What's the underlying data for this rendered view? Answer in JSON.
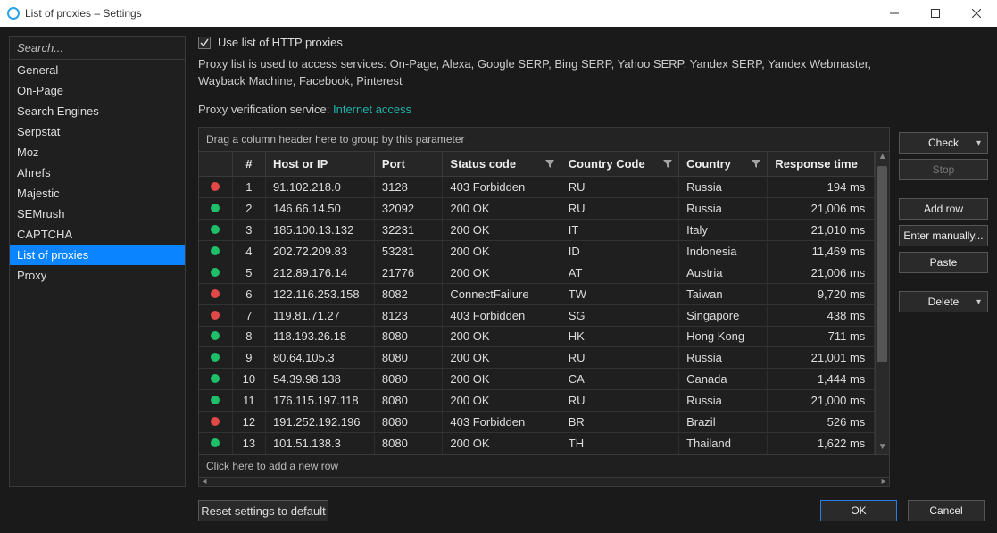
{
  "window": {
    "title": "List of proxies – Settings"
  },
  "sidebar": {
    "search_placeholder": "Search...",
    "items": [
      {
        "label": "General"
      },
      {
        "label": "On-Page"
      },
      {
        "label": "Search Engines"
      },
      {
        "label": "Serpstat"
      },
      {
        "label": "Moz"
      },
      {
        "label": "Ahrefs"
      },
      {
        "label": "Majestic"
      },
      {
        "label": "SEMrush"
      },
      {
        "label": "CAPTCHA"
      },
      {
        "label": "List of proxies"
      },
      {
        "label": "Proxy"
      }
    ],
    "selected_index": 9
  },
  "main": {
    "checkbox_label": "Use list of HTTP proxies",
    "checkbox_checked": true,
    "description": "Proxy list is used to access services: On-Page, Alexa, Google SERP, Bing SERP, Yahoo SERP, Yandex SERP, Yandex Webmaster, Wayback Machine, Facebook, Pinterest",
    "verification_label": "Proxy verification service: ",
    "verification_link": "Internet access",
    "group_hint": "Drag a column header here to group by this parameter",
    "columns": {
      "num": "#",
      "host": "Host or IP",
      "port": "Port",
      "status": "Status code",
      "cc": "Country Code",
      "country": "Country",
      "rt": "Response time"
    },
    "rows": [
      {
        "ok": false,
        "n": "1",
        "ip": "91.102.218.0",
        "port": "3128",
        "status": "403 Forbidden",
        "cc": "RU",
        "country": "Russia",
        "rt": "194 ms"
      },
      {
        "ok": true,
        "n": "2",
        "ip": "146.66.14.50",
        "port": "32092",
        "status": "200 OK",
        "cc": "RU",
        "country": "Russia",
        "rt": "21,006 ms"
      },
      {
        "ok": true,
        "n": "3",
        "ip": "185.100.13.132",
        "port": "32231",
        "status": "200 OK",
        "cc": "IT",
        "country": "Italy",
        "rt": "21,010 ms"
      },
      {
        "ok": true,
        "n": "4",
        "ip": "202.72.209.83",
        "port": "53281",
        "status": "200 OK",
        "cc": "ID",
        "country": "Indonesia",
        "rt": "11,469 ms"
      },
      {
        "ok": true,
        "n": "5",
        "ip": "212.89.176.14",
        "port": "21776",
        "status": "200 OK",
        "cc": "AT",
        "country": "Austria",
        "rt": "21,006 ms"
      },
      {
        "ok": false,
        "n": "6",
        "ip": "122.116.253.158",
        "port": "8082",
        "status": "ConnectFailure",
        "cc": "TW",
        "country": "Taiwan",
        "rt": "9,720 ms"
      },
      {
        "ok": false,
        "n": "7",
        "ip": "119.81.71.27",
        "port": "8123",
        "status": "403 Forbidden",
        "cc": "SG",
        "country": "Singapore",
        "rt": "438 ms"
      },
      {
        "ok": true,
        "n": "8",
        "ip": "118.193.26.18",
        "port": "8080",
        "status": "200 OK",
        "cc": "HK",
        "country": "Hong Kong",
        "rt": "711 ms"
      },
      {
        "ok": true,
        "n": "9",
        "ip": "80.64.105.3",
        "port": "8080",
        "status": "200 OK",
        "cc": "RU",
        "country": "Russia",
        "rt": "21,001 ms"
      },
      {
        "ok": true,
        "n": "10",
        "ip": "54.39.98.138",
        "port": "8080",
        "status": "200 OK",
        "cc": "CA",
        "country": "Canada",
        "rt": "1,444 ms"
      },
      {
        "ok": true,
        "n": "11",
        "ip": "176.115.197.118",
        "port": "8080",
        "status": "200 OK",
        "cc": "RU",
        "country": "Russia",
        "rt": "21,000 ms"
      },
      {
        "ok": false,
        "n": "12",
        "ip": "191.252.192.196",
        "port": "8080",
        "status": "403 Forbidden",
        "cc": "BR",
        "country": "Brazil",
        "rt": "526 ms"
      },
      {
        "ok": true,
        "n": "13",
        "ip": "101.51.138.3",
        "port": "8080",
        "status": "200 OK",
        "cc": "TH",
        "country": "Thailand",
        "rt": "1,622 ms"
      }
    ],
    "new_row_hint": "Click here to add a new row"
  },
  "buttons": {
    "check": "Check",
    "stop": "Stop",
    "add_row": "Add row",
    "enter_manually": "Enter manually...",
    "paste": "Paste",
    "delete": "Delete",
    "reset": "Reset settings to default",
    "ok": "OK",
    "cancel": "Cancel"
  }
}
